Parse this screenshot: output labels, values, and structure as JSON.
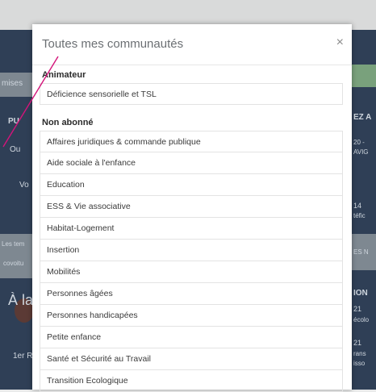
{
  "background": {
    "left_fragments": [
      "mises",
      "PU",
      "Ou",
      "Vo",
      "Les tem",
      "covoitu",
      "À la",
      "1er R"
    ],
    "right_fragments": [
      "EZ A",
      "20 -",
      "AVIG",
      "14",
      "téfic",
      "ES N",
      "ION",
      "21",
      "écolo",
      "21",
      "rans",
      "isso"
    ]
  },
  "modal": {
    "title": "Toutes mes communautés",
    "close_label": "×",
    "sections": [
      {
        "heading": "Animateur",
        "items": [
          "Déficience sensorielle et TSL"
        ]
      },
      {
        "heading": "Non abonné",
        "items": [
          "Affaires juridiques & commande publique",
          "Aide sociale à l'enfance",
          "Education",
          "ESS & Vie associative",
          "Habitat-Logement",
          "Insertion",
          "Mobilités",
          "Personnes âgées",
          "Personnes handicapées",
          "Petite enfance",
          "Santé et Sécurité au Travail",
          "Transition Ecologique"
        ]
      }
    ]
  },
  "colors": {
    "annotation_line": "#d4147a",
    "background_panel": "#2f3f56"
  }
}
